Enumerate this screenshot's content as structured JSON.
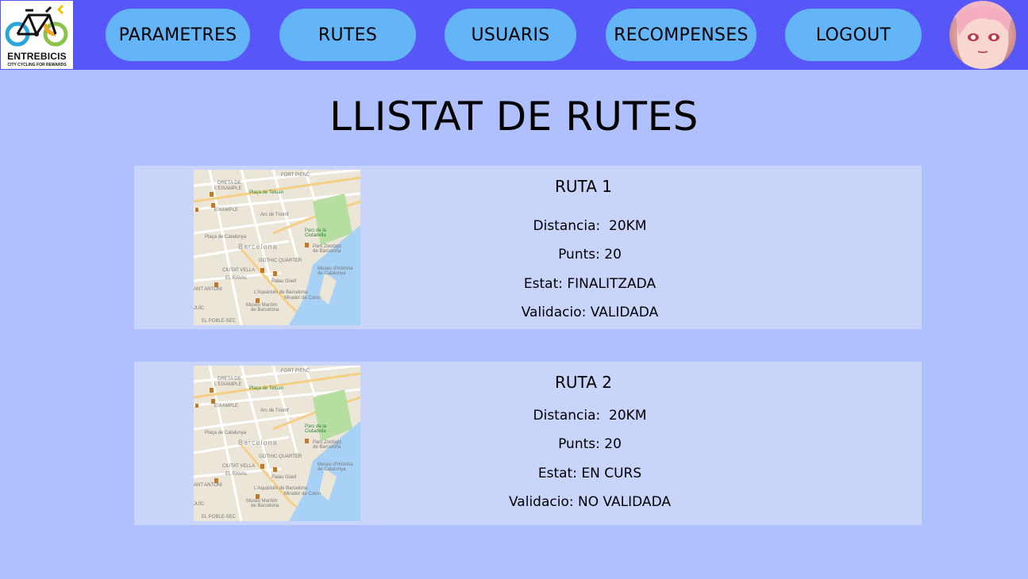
{
  "header": {
    "logo": {
      "name": "ENTREBICIS",
      "tagline": "CITY CYCLING FOR REWARDS"
    },
    "nav": [
      "PARAMETRES",
      "RUTES",
      "USUARIS",
      "RECOMPENSES",
      "LOGOUT"
    ]
  },
  "main": {
    "title": "LLISTAT DE RUTES",
    "routes": [
      {
        "title": "RUTA 1",
        "distance": "Distancia:  20KM",
        "points": "Punts: 20",
        "status": "Estat: FINALITZADA",
        "validation": "Validacio: VALIDADA"
      },
      {
        "title": "RUTA 2",
        "distance": "Distancia:  20KM",
        "points": "Punts: 20",
        "status": "Estat: EN CURS",
        "validation": "Validacio: NO VALIDADA"
      }
    ]
  },
  "map_labels": [
    "DRETA DE L'EIXAMPLE",
    "FORT PIENC",
    "Plaça de Tetuan",
    "Arc de Triomf",
    "EIXAMPLE",
    "Plaça de Catalunya",
    "Parc de la Ciutadella",
    "Barcelona",
    "Parc Zoològic de Barcelona",
    "GOTHIC QUARTER",
    "CIUTAT VELLA",
    "EL RAVAL",
    "Museu d'Història de Catalunya",
    "Palau Güell",
    "L'Aquàrium de Barcelona",
    "Mirador de Colom",
    "Museu Marítim de Barcelona",
    "EL POBLE-SEC",
    "SANT ANTONI",
    "MONTJUÏC"
  ]
}
